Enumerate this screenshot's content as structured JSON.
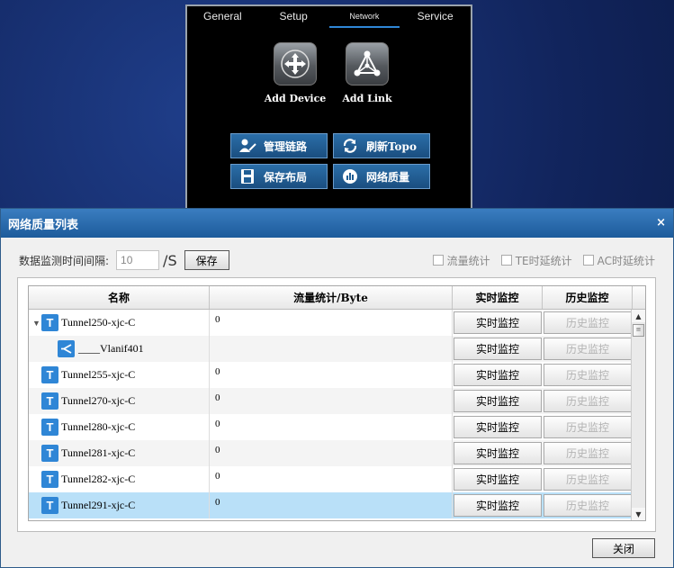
{
  "top_panel": {
    "tabs": [
      {
        "label": "General"
      },
      {
        "label": "Setup"
      },
      {
        "label": "Network"
      },
      {
        "label": "Service"
      }
    ],
    "active_tab": "Network",
    "big_buttons": {
      "add_device": "Add Device",
      "add_link": "Add Link"
    },
    "actions": {
      "manage_links": "管理链路",
      "refresh_topo": "刷新Topo",
      "save_layout": "保存布局",
      "network_quality": "网络质量"
    }
  },
  "dialog": {
    "title": "网络质量列表",
    "close_glyph": "×",
    "interval_label": "数据监测时间间隔:",
    "interval_value": "10",
    "interval_unit": "/S",
    "save_label": "保存",
    "checks": {
      "traffic": "流量统计",
      "te_delay": "TE时延统计",
      "ac_delay": "AC时延统计"
    },
    "columns": {
      "name": "名称",
      "flow": "流量统计/Byte",
      "realtime": "实时监控",
      "history": "历史监控"
    },
    "rows": [
      {
        "name": "Tunnel250-xjc-C",
        "flow": "0",
        "realtime": "实时监控",
        "history": "历史监控"
      },
      {
        "name": "____Vlanif401",
        "flow": "",
        "realtime": "实时监控",
        "history": "历史监控"
      },
      {
        "name": "Tunnel255-xjc-C",
        "flow": "0",
        "realtime": "实时监控",
        "history": "历史监控"
      },
      {
        "name": "Tunnel270-xjc-C",
        "flow": "0",
        "realtime": "实时监控",
        "history": "历史监控"
      },
      {
        "name": "Tunnel280-xjc-C",
        "flow": "0",
        "realtime": "实时监控",
        "history": "历史监控"
      },
      {
        "name": "Tunnel281-xjc-C",
        "flow": "0",
        "realtime": "实时监控",
        "history": "历史监控"
      },
      {
        "name": "Tunnel282-xjc-C",
        "flow": "0",
        "realtime": "实时监控",
        "history": "历史监控"
      },
      {
        "name": "Tunnel291-xjc-C",
        "flow": "0",
        "realtime": "实时监控",
        "history": "历史监控"
      }
    ],
    "close_label": "关闭"
  },
  "colors": {
    "accent": "#2f86d6",
    "titlebar": "#2a6cae",
    "selected_row": "#b9e0f8"
  },
  "icons": [
    "move-arrows-icon",
    "topology-link-icon",
    "user-link-icon",
    "refresh-icon",
    "floppy-save-icon",
    "chart-quality-icon",
    "tunnel-icon",
    "vlan-icon"
  ]
}
